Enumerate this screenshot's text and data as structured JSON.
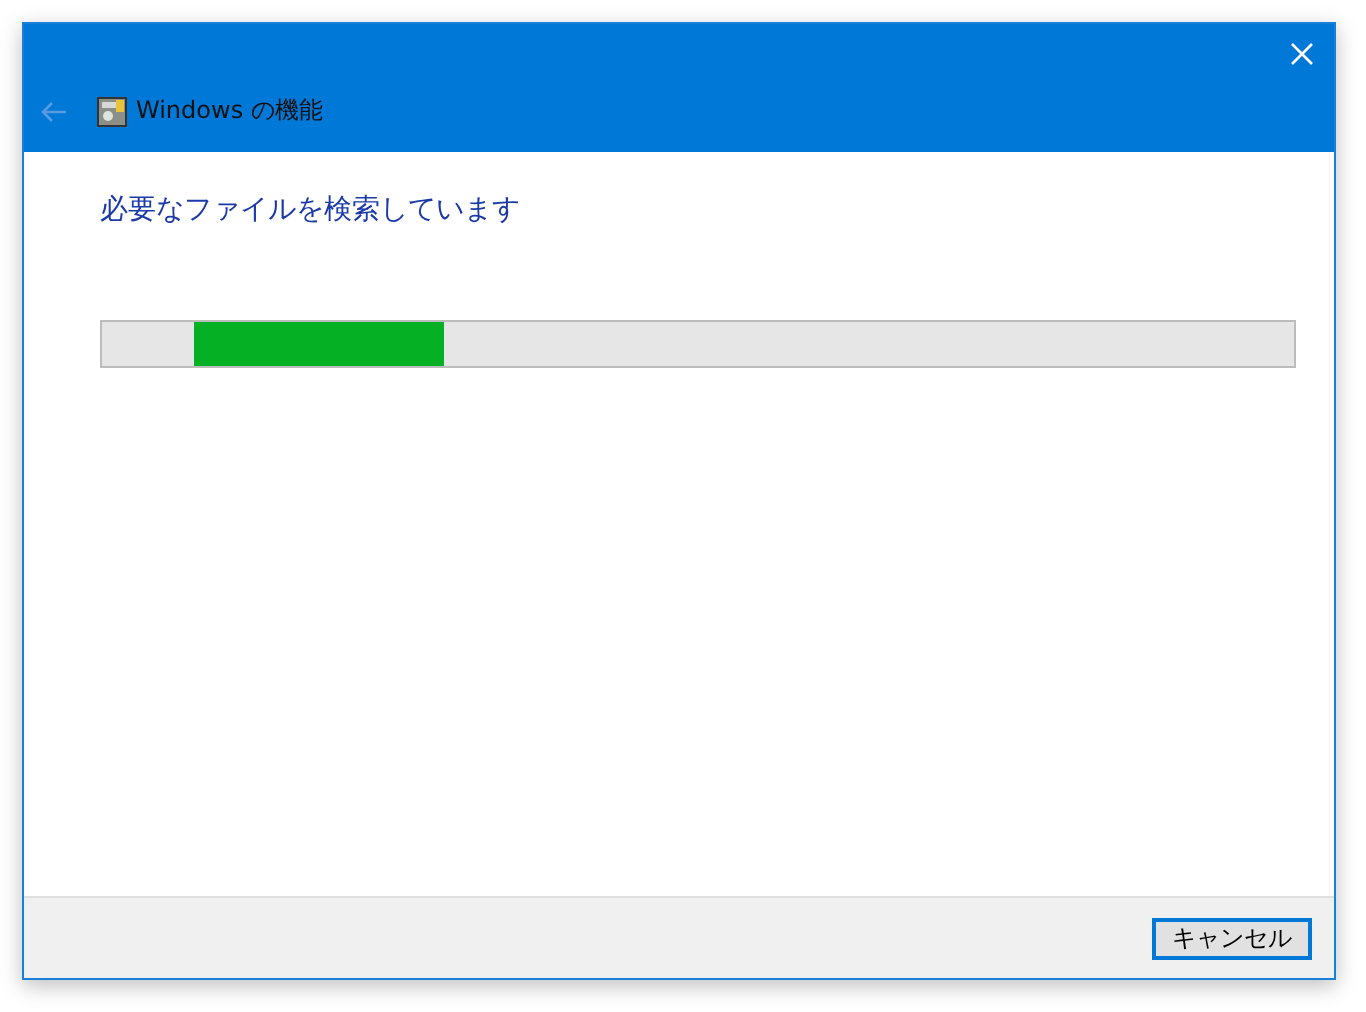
{
  "window": {
    "title": "Windows の機能"
  },
  "heading": "必要なファイルを検索しています",
  "progress": {
    "kind": "marquee",
    "level": 0.21
  },
  "buttons": [
    {
      "label": "キャンセル",
      "focused": true
    }
  ]
}
